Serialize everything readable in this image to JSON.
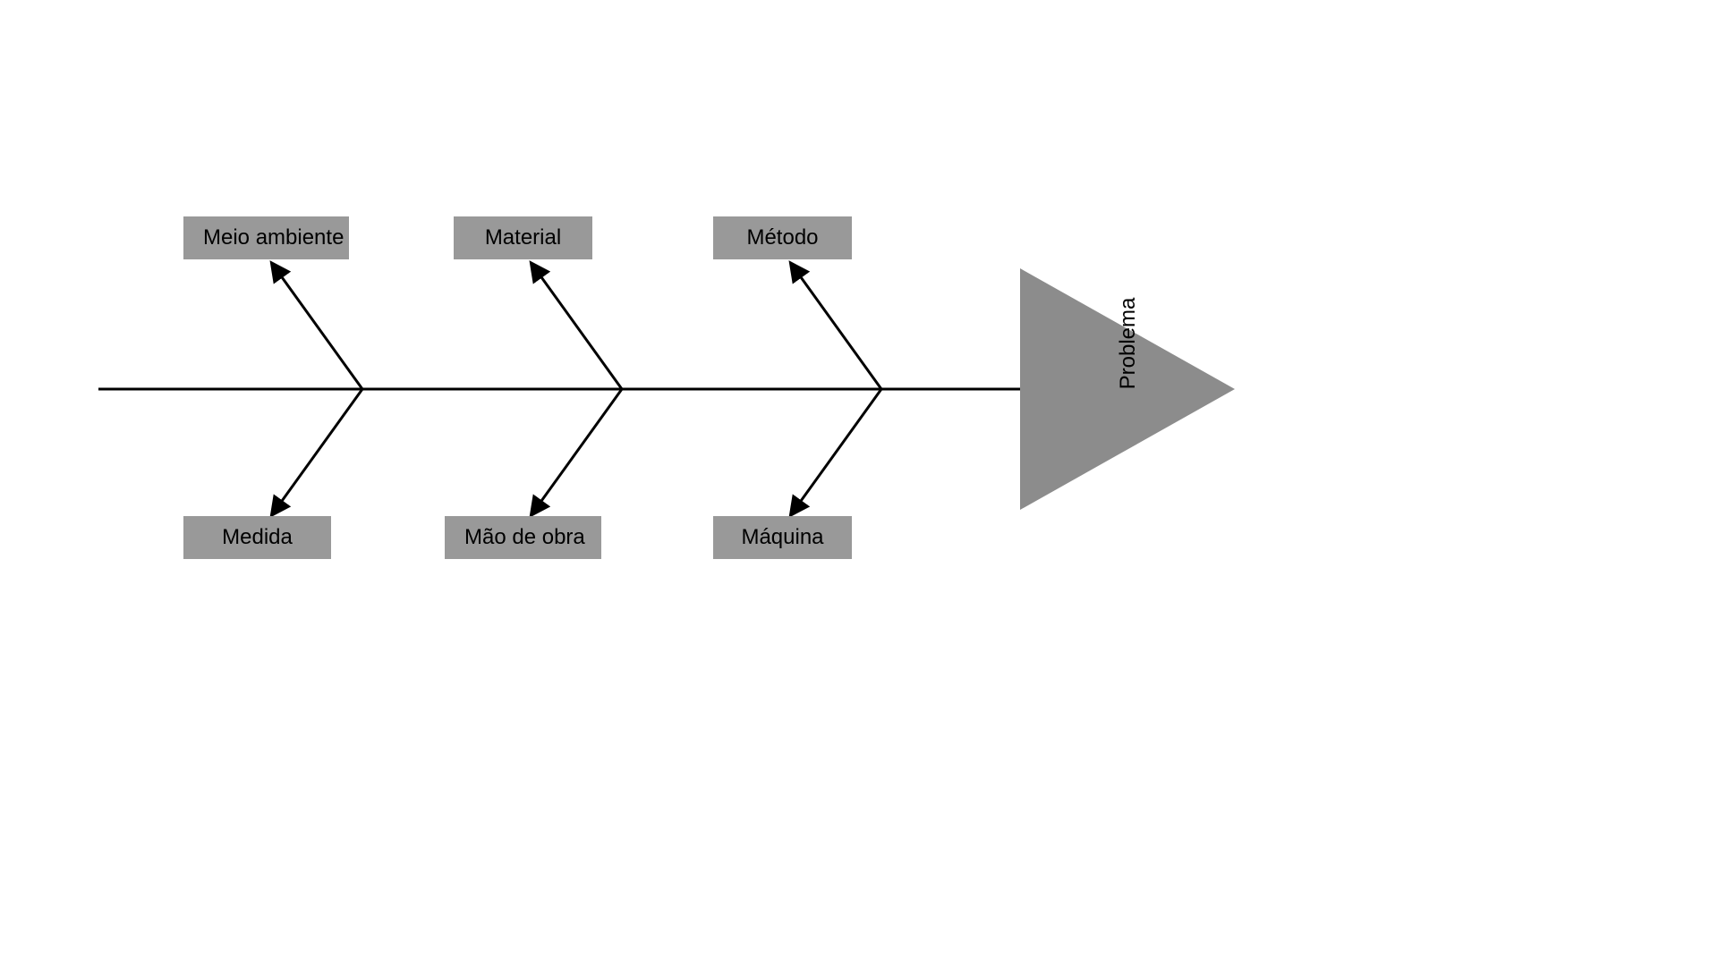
{
  "diagram": {
    "type": "fishbone",
    "head_label": "Problema",
    "categories": {
      "top": [
        {
          "label": "Meio ambiente"
        },
        {
          "label": "Material"
        },
        {
          "label": "Método"
        }
      ],
      "bottom": [
        {
          "label": "Medida"
        },
        {
          "label": "Mão de obra"
        },
        {
          "label": "Máquina"
        }
      ]
    },
    "colors": {
      "box_bg": "#999999",
      "head_fill": "#8c8c8c",
      "line": "#000000",
      "text": "#000000"
    }
  }
}
